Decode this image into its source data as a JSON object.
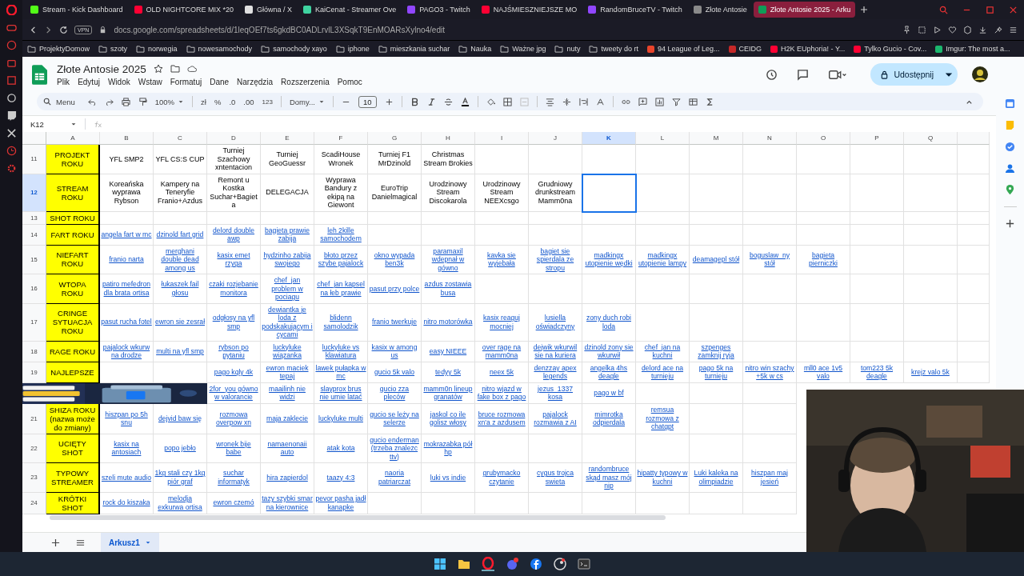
{
  "browser": {
    "tabs": [
      {
        "title": "Stream - Kick Dashboard",
        "selected": false,
        "color": "#53fc18"
      },
      {
        "title": "OLD NIGHTCORE MIX *20",
        "selected": false,
        "color": "#ff0033"
      },
      {
        "title": "Główna / X",
        "selected": false,
        "color": "#e0e0e0"
      },
      {
        "title": "KaiCenat - Streamer Ove",
        "selected": false,
        "color": "#3fd3a0"
      },
      {
        "title": "PAGO3 - Twitch",
        "selected": false,
        "color": "#9146ff"
      },
      {
        "title": "NAJŚMIESZNIEJSZE MO",
        "selected": false,
        "color": "#ff0033"
      },
      {
        "title": "RandomBruceTV - Twitch",
        "selected": false,
        "color": "#9146ff"
      },
      {
        "title": "Złote Antosie",
        "selected": false,
        "color": "#8a8a8a"
      },
      {
        "title": "Złote Antosie 2025 - Arku",
        "selected": true,
        "color": "#0f9d58"
      }
    ],
    "vpn_badge": "VPN",
    "url": "docs.google.com/spreadsheets/d/1leqOEf7ts6gkdBC0ADLrvlL3XSqkT9EnMOARsXylno4/edit",
    "bookmarks": [
      {
        "label": "ProjektyDomow",
        "kind": "folder"
      },
      {
        "label": "szoty",
        "kind": "folder"
      },
      {
        "label": "norwegia",
        "kind": "folder"
      },
      {
        "label": "nowesamochody",
        "kind": "folder"
      },
      {
        "label": "samochody xayo",
        "kind": "folder"
      },
      {
        "label": "iphone",
        "kind": "folder"
      },
      {
        "label": "mieszkania suchar",
        "kind": "folder"
      },
      {
        "label": "Nauka",
        "kind": "folder"
      },
      {
        "label": "Ważne jpg",
        "kind": "folder"
      },
      {
        "label": "nuty",
        "kind": "folder"
      },
      {
        "label": "tweety do rt",
        "kind": "folder"
      },
      {
        "label": "94 League of Leg...",
        "kind": "site",
        "color": "#e8442b"
      },
      {
        "label": "CEIDG",
        "kind": "site",
        "color": "#c62828"
      },
      {
        "label": "H2K EUphoria! - Y...",
        "kind": "site",
        "color": "#ff0033"
      },
      {
        "label": "Tylko Gucio - Cov...",
        "kind": "site",
        "color": "#ff0033"
      },
      {
        "label": "Imgur: The most a...",
        "kind": "site",
        "color": "#1bb76e"
      }
    ]
  },
  "doc": {
    "title": "Złote Antosie 2025",
    "menus": [
      "Plik",
      "Edytuj",
      "Widok",
      "Wstaw",
      "Formatuj",
      "Dane",
      "Narzędzia",
      "Rozszerzenia",
      "Pomoc"
    ],
    "share_button": "Udostępnij"
  },
  "toolbar": {
    "search": "Menu",
    "zoom": "100%",
    "currency": "zł",
    "percent": "%",
    "decrease_decimals": ".0",
    "increase_decimals": ".00",
    "number_format": "123",
    "font": "Domy...",
    "font_size": "10"
  },
  "formula_bar": {
    "name_box": "K12"
  },
  "columns": [
    {
      "label": "A",
      "selected": false
    },
    {
      "label": "B",
      "selected": false
    },
    {
      "label": "C",
      "selected": false
    },
    {
      "label": "D",
      "selected": false
    },
    {
      "label": "E",
      "selected": false
    },
    {
      "label": "F",
      "selected": false
    },
    {
      "label": "G",
      "selected": false
    },
    {
      "label": "H",
      "selected": false
    },
    {
      "label": "I",
      "selected": false
    },
    {
      "label": "J",
      "selected": false
    },
    {
      "label": "K",
      "selected": true
    },
    {
      "label": "L",
      "selected": false
    },
    {
      "label": "M",
      "selected": false
    },
    {
      "label": "N",
      "selected": false
    },
    {
      "label": "O",
      "selected": false
    },
    {
      "label": "P",
      "selected": false
    },
    {
      "label": "Q",
      "selected": false
    }
  ],
  "rows": [
    {
      "number": "11",
      "selected": false,
      "kind": "plain",
      "cells": [
        "PROJEKT ROKU",
        "YFL SMP2",
        "YFL CS:S CUP",
        "Turniej Szachowy xntentacion",
        "Turniej GeoGuessr",
        "ScadiHouse Wronek",
        "Turniej F1 MrDzinold",
        "Christmas Stream Brokies"
      ]
    },
    {
      "number": "12",
      "selected": true,
      "kind": "plain",
      "cells": [
        "STREAM ROKU",
        "Koreańska wyprawa Rybson",
        "Kampery na Teneryfie Franio+Azdus",
        "Remont u Kostka Suchar+Bagieta",
        "DELEGACJA",
        "Wyprawa Bandury z ekipą na Giewont",
        "EuroTrip Danielmagical",
        "Urodzinowy Stream Discokarola",
        "Urodzinowy Stream NEEXcsgo",
        "Grudniowy drunkstream Mamm0na"
      ]
    },
    {
      "number": "13",
      "selected": false,
      "cells": [
        "SHOT ROKU"
      ]
    },
    {
      "number": "14",
      "selected": false,
      "kind": "link",
      "cells": [
        "FART ROKU",
        "angela fart w mc",
        "dzinold fart grid",
        "delord double awp",
        "bagieta prawie zabija",
        "leh 2kille samochodem"
      ]
    },
    {
      "number": "15",
      "selected": false,
      "kind": "link",
      "cells": [
        "NIEFART ROKU",
        "franio narta",
        "merghani double dead among us",
        "kasix emet rzyga",
        "hydzinho zabija swojego",
        "błoto przez szybe pajalock",
        "okno wypada ben3k",
        "paramaxil wdepnał w gówno",
        "kavka sie wyjebała",
        "bagiet sie spierdala ze stropu",
        "madkingx utopienie wędki",
        "madkingx utopienie lampy",
        "deamagepl stół",
        "boguslaw_ny stół",
        "bagieta pierniczki"
      ]
    },
    {
      "number": "16",
      "selected": false,
      "kind": "link",
      "cells": [
        "WTOPA ROKU",
        "patiro mefedron dla brata ortisa",
        "łukaszek fail głosu",
        "czaki rozjebanie monitora",
        "chef_jan problem w pociagu",
        "chef_jan kapsel na łeb prawie",
        "pasut przy polce",
        "azdus zostawia busa"
      ]
    },
    {
      "number": "17",
      "selected": false,
      "kind": "link",
      "cells": [
        "CRINGE SYTUACJA ROKU",
        "pasut rucha fotel",
        "ewron sie zesrał",
        "odgłosy na yfl smp",
        "dewiantka je loda z podskakującym i cycami",
        "blidenn samolodzik",
        "franio twerkuje",
        "nitro motorówka",
        "kasix reaguj mocniej",
        "lusiella oświadczyny",
        "zony duch robi loda"
      ]
    },
    {
      "number": "18",
      "selected": false,
      "kind": "link",
      "cells": [
        "RAGE ROKU",
        "pajalock wkurw na drodze",
        "multi na yfl smp",
        "rybson po pytaniu",
        "luckyluke wiązanka",
        "luckyluke vs klawiatura",
        "kasix w among us",
        "easy NIEEE",
        "over rage na mamm0na",
        "dejwik wkurwil sie na kuriera",
        "dzinold zony sie wkurwił",
        "chef_jan na kuchni",
        "szpenges zamknij ryja"
      ]
    },
    {
      "number": "19",
      "selected": false,
      "kind": "link",
      "cells": [
        "NAJLEPSZE",
        null,
        null,
        "pago kqly 4k",
        "ewron maciek tepaj",
        "lawek pułapka w mc",
        "gucio 5k valo",
        "tedyy 5k",
        "neex 5k",
        "denzzay apex legends",
        "angelka 4hs deagle",
        "delord ace na turnieju",
        "pago 5k na turnieju",
        "nitro win szachy +5k w cs",
        "mll0 ace 1v5 valo",
        "tom223 5k deagle",
        "krejz valo 5k"
      ]
    },
    {
      "kind": "link",
      "cells": [
        null,
        null,
        null,
        "2for_you gówno w valorancie",
        "maailinh nie widzi",
        "slayprox brus nie umie latać",
        "gucio zza pleców",
        "mamm0n lineup granatów",
        "nitro wjazd w fake box z pago",
        "jezus_1337 kosa",
        "pago w bf"
      ]
    },
    {
      "number": "21",
      "selected": false,
      "kind": "link",
      "cells": [
        "SHIZA ROKU (nazwa może do zmiany)",
        "hiszpan po 5h snu",
        "dejvid baw się",
        "rozmowa overpow xn",
        "maja zaklecie",
        "luckyluke multi",
        "gucio se leży na selerze",
        "jaskol co ile golisz włosy",
        "bruce rozmowa xn'a z azdusem",
        "pajalock rozmawia z AI",
        "mimrotka odpierdala",
        "remsua rozmowa z chatgpt"
      ]
    },
    {
      "number": "22",
      "selected": false,
      "kind": "link",
      "cells": [
        "UCIĘTY SHOT",
        "kasix na antosiach",
        "popo jebło",
        "wronek bije babe",
        "namaenonaii auto",
        "atak kota",
        "gucio enderman (trzeba znalezc ttv)",
        "mokrazabka pół hp"
      ]
    },
    {
      "number": "23",
      "selected": false,
      "kind": "link",
      "cells": [
        "TYPOWY STREAMER",
        "szeli mute audio",
        "1kg stali czy 1kg piór graf",
        "suchar informatyk",
        "hira zapierdol",
        "taazy 4:3",
        "naoria patriarczat",
        "luki vs indie",
        "grubymacko czytanie",
        "cygus trojca swieta",
        "randombruce skąd masz mój nip",
        "hipatty typowy w kuchni",
        "Luki kaleka na olimpiadzie",
        "hiszpan maj jesień"
      ]
    },
    {
      "number": "24",
      "selected": false,
      "kind": "link",
      "cells": [
        "KRÓTKI SHOT",
        "rock do kiszaka",
        "melodja exkurwa ortisa",
        "ewron czemó",
        "tazy szybki smar na kierownice",
        "pevor pasha jadł kanapke"
      ]
    }
  ],
  "sheet_tabs": [
    {
      "label": "Arkusz1",
      "selected": true
    }
  ]
}
